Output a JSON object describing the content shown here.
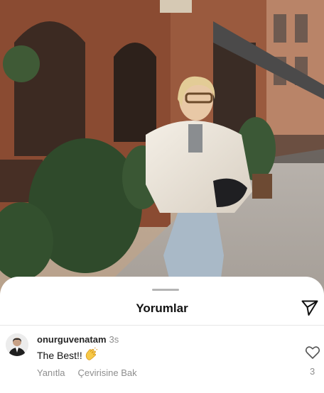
{
  "sheet": {
    "title": "Yorumlar"
  },
  "comment": {
    "username": "onurguvenatam",
    "time": "3s",
    "text": "The Best!!",
    "text_emoji": "clapping-hands-icon",
    "reply_label": "Yanıtla",
    "translate_label": "Çevirisine Bak",
    "like_count": "3"
  },
  "icons": {
    "share": "paper-plane-icon",
    "like": "heart-outline-icon",
    "avatar": "user-avatar"
  }
}
